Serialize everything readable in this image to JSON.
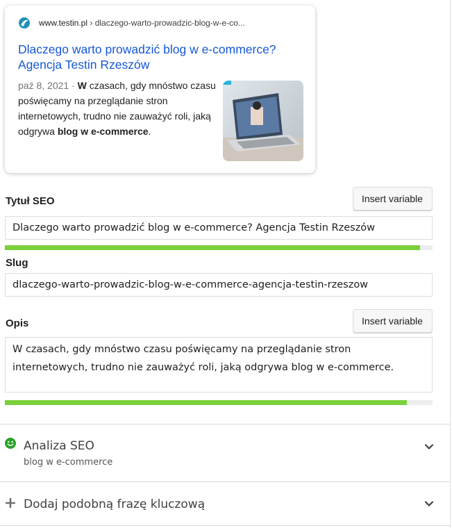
{
  "preview": {
    "url_site": "www.testin.pl",
    "url_path": " › dlaczego-warto-prowadzic-blog-w-e-co...",
    "title": "Dlaczego warto prowadzić blog w e-commerce? Agencja Testin Rzeszów",
    "date": "paź 8, 2021 · ",
    "snippet_bold_start": "W",
    "snippet_mid": " czasach, gdy mnóstwo czasu poświęcamy na przeglądanie stron internetowych, trudno nie zauważyć roli, jaką odgrywa ",
    "snippet_bold_end": "blog w e-commerce",
    "snippet_end": "."
  },
  "seo_title": {
    "label": "Tytuł SEO",
    "insert_label": "Insert variable",
    "value": "Dlaczego warto prowadzić blog w e-commerce? Agencja Testin Rzeszów",
    "progress": 0.97
  },
  "slug": {
    "label": "Slug",
    "value": "dlaczego-warto-prowadzic-blog-w-e-commerce-agencja-testin-rzeszow"
  },
  "description": {
    "label": "Opis",
    "insert_label": "Insert variable",
    "value": "W czasach, gdy mnóstwo czasu poświęcamy na przeglądanie stron internetowych, trudno nie zauważyć roli, jaką odgrywa blog w e-commerce.",
    "progress": 0.94
  },
  "seo_analysis": {
    "title": "Analiza SEO",
    "keyphrase": "blog w e-commerce",
    "status_color": "#7ad03a"
  },
  "related_keyphrase": {
    "title": "Dodaj podobną frazę kluczową"
  },
  "colors": {
    "link": "#1a0dab",
    "progress_good": "#7ad03a"
  }
}
